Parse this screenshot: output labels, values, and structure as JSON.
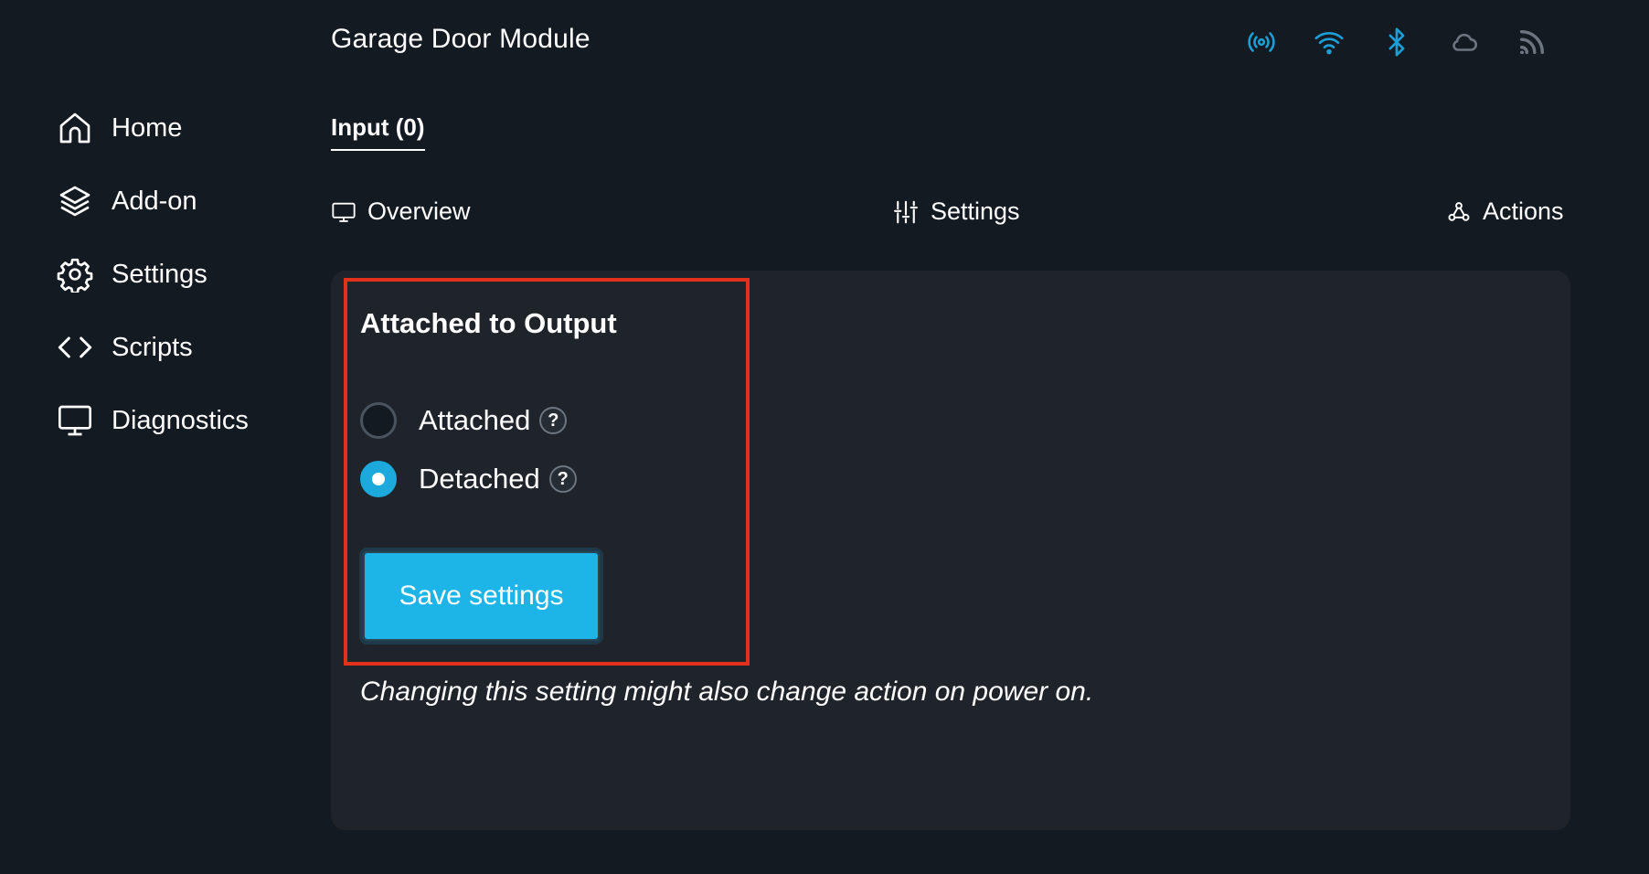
{
  "header": {
    "title": "Garage Door Module",
    "status_icons": [
      {
        "name": "broadcast-icon",
        "color": "#1c9fd6"
      },
      {
        "name": "wifi-icon",
        "color": "#1c9fd6"
      },
      {
        "name": "bluetooth-icon",
        "color": "#1c9fd6"
      },
      {
        "name": "cloud-icon",
        "color": "#6d7580"
      },
      {
        "name": "rss-icon",
        "color": "#6d7580"
      }
    ]
  },
  "sidebar": {
    "items": [
      {
        "label": "Home",
        "icon": "home-icon"
      },
      {
        "label": "Add-on",
        "icon": "layers-icon"
      },
      {
        "label": "Settings",
        "icon": "gear-icon"
      },
      {
        "label": "Scripts",
        "icon": "code-icon"
      },
      {
        "label": "Diagnostics",
        "icon": "monitor-icon"
      }
    ]
  },
  "tabs": {
    "active": "Input (0)"
  },
  "subnav": {
    "overview": "Overview",
    "settings": "Settings",
    "actions": "Actions"
  },
  "panel": {
    "title": "Attached to Output",
    "options": [
      {
        "label": "Attached",
        "selected": false,
        "help": "?"
      },
      {
        "label": "Detached",
        "selected": true,
        "help": "?"
      }
    ],
    "save_label": "Save settings",
    "note": "Changing this setting might also change action on power on."
  },
  "colors": {
    "accent": "#1db4e7",
    "highlight": "#e2311d",
    "background": "#141a21",
    "panel": "#1f242b"
  }
}
